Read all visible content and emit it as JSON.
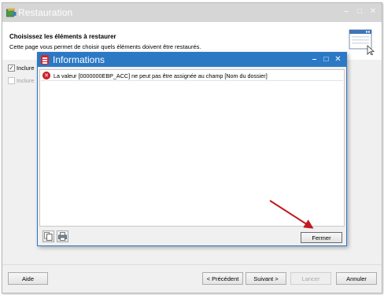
{
  "window": {
    "title": "Restauration",
    "heading": "Choisissez les éléments à restaurer",
    "description": "Cette page vous permet de choisir quels éléments doivent être restaurés."
  },
  "options": [
    {
      "label": "Inclure",
      "checked": true,
      "enabled": true
    },
    {
      "label": "Inclure",
      "checked": false,
      "enabled": false
    }
  ],
  "footer": {
    "help": "Aide",
    "previous": "< Précédent",
    "next": "Suivant >",
    "launch": "Lancer",
    "cancel": "Annuler"
  },
  "dialog": {
    "title": "Informations",
    "messages": [
      {
        "level": "error",
        "icon": "error-icon",
        "text": "La valeur [0000000EBP_ACC] ne peut pas être assignée au champ [Nom du dossier]"
      }
    ],
    "close_label": "Fermer"
  },
  "colors": {
    "dialog_titlebar": "#2b78c5",
    "main_titlebar": "#d6d6d6",
    "error": "#d9232b",
    "arrow": "#c0191f"
  }
}
